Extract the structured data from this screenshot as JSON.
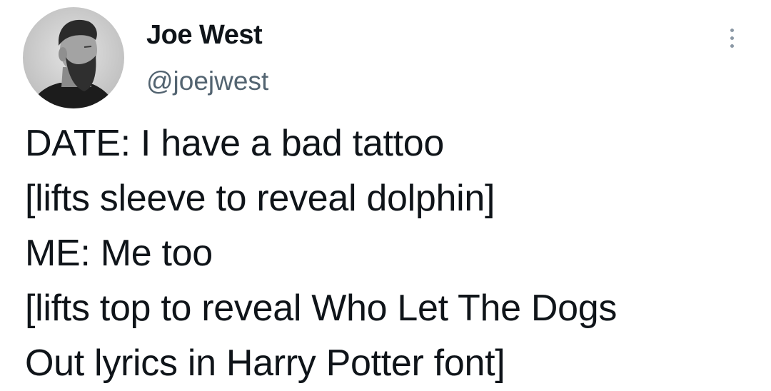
{
  "author": {
    "display_name": "Joe West",
    "handle": "@joejwest",
    "avatar_icon": "profile-photo-bearded-man"
  },
  "menu": {
    "icon": "more-options-icon"
  },
  "tweet": {
    "lines": [
      "DATE: I have a bad tattoo",
      "[lifts sleeve to reveal dolphin]",
      "ME: Me too",
      "[lifts top to reveal Who Let The Dogs",
      "Out lyrics in Harry Potter font]"
    ]
  },
  "colors": {
    "text": "#0f1419",
    "secondary": "#536471",
    "background": "#ffffff"
  }
}
